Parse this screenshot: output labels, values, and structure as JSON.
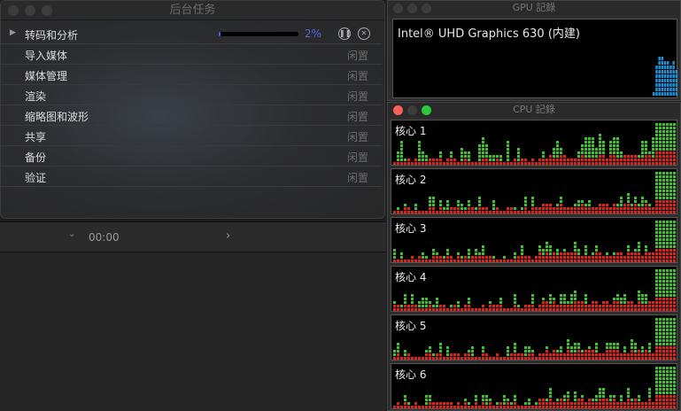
{
  "editor": {
    "timecode": "00:00"
  },
  "background_tasks": {
    "title": "后台任务",
    "rows": [
      {
        "label": "转码和分析",
        "progress_label": "2%",
        "progress": 0.02,
        "expandable": true
      },
      {
        "label": "导入媒体",
        "status": "闲置"
      },
      {
        "label": "媒体管理",
        "status": "闲置"
      },
      {
        "label": "渲染",
        "status": "闲置"
      },
      {
        "label": "缩略图和波形",
        "status": "闲置"
      },
      {
        "label": "共享",
        "status": "闲置"
      },
      {
        "label": "备份",
        "status": "闲置"
      },
      {
        "label": "验证",
        "status": "闲置"
      }
    ],
    "icons": {
      "pause": "pause-circle-icon",
      "cancel": "x-circle-icon"
    }
  },
  "gpu_history": {
    "title": "GPU 記錄",
    "gpu_name": "Intel® UHD Graphics 630 (内建)",
    "color": "#1e90d6"
  },
  "cpu_history": {
    "title": "CPU 記錄",
    "cores": [
      "核心 1",
      "核心 2",
      "核心 3",
      "核心 4",
      "核心 5",
      "核心 6"
    ],
    "user_color": "#3ec42a",
    "system_color": "#e2231a"
  }
}
